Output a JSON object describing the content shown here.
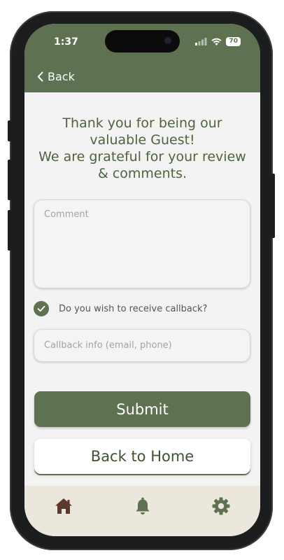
{
  "status": {
    "time": "1:37",
    "battery": "70"
  },
  "nav": {
    "back_label": "Back"
  },
  "message": {
    "line1": "Thank you for being our",
    "line2": "valuable Guest!",
    "line3": "We are grateful for your review",
    "line4": "& comments."
  },
  "form": {
    "comment_placeholder": "Comment",
    "callback_checked": true,
    "callback_question": "Do you wish to receive callback?",
    "callback_placeholder": "Callback info (email, phone)"
  },
  "buttons": {
    "submit_label": "Submit",
    "home_label": "Back to Home"
  },
  "tabbar": {
    "items": [
      {
        "icon": "home-icon",
        "active": true
      },
      {
        "icon": "bell-icon",
        "active": false
      },
      {
        "icon": "gear-icon",
        "active": false
      }
    ]
  },
  "colors": {
    "primary": "#5e7150",
    "text_green": "#4e6340",
    "home_icon": "#5a3a2e",
    "tabbar_bg": "#ece7dc"
  }
}
